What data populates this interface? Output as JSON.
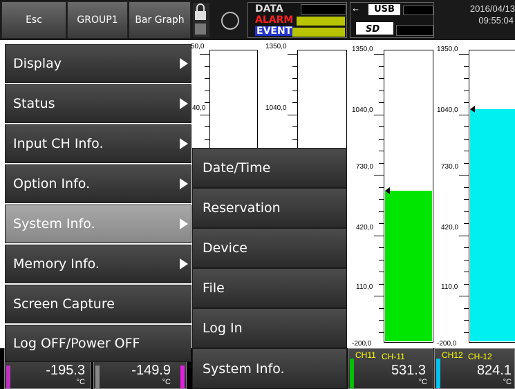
{
  "topbar": {
    "esc_label": "Esc",
    "group_label": "GROUP1",
    "view_label": "Bar Graph",
    "data_label": "DATA",
    "alarm_label": "ALARM",
    "event_label": "EVENT",
    "usb_label": "USB",
    "date": "2016/04/13",
    "time": "09:55:04"
  },
  "chart": {
    "bars": [
      {
        "scale": [
          "50,0",
          "40,0"
        ]
      },
      {
        "scale": [
          "1350,0",
          "1040,0"
        ]
      },
      {
        "scale": [
          "1350,0",
          "1040,0",
          "730,0",
          "420,0",
          "110,0",
          "-200,0"
        ],
        "level_pct": 52
      },
      {
        "scale": [
          "1350,0",
          "1040,0",
          "730,0",
          "420,0",
          "110,0",
          "-200,0"
        ],
        "level_pct": 80
      }
    ],
    "colors": {
      "ch11": "#00e600",
      "ch12": "#00f0f0"
    }
  },
  "bottom": {
    "tiles": [
      {
        "value": "-195.3",
        "unit": "°C"
      },
      {
        "value": "-149.9",
        "unit": "°C"
      },
      {
        "ch": "CH11",
        "name": "CH-11",
        "value": "531.3",
        "unit": "°C"
      },
      {
        "ch": "CH12",
        "name": "CH-12",
        "value": "824.1",
        "unit": "°C"
      }
    ]
  },
  "menu": {
    "items": [
      {
        "label": "Display"
      },
      {
        "label": "Status"
      },
      {
        "label": "Input CH Info."
      },
      {
        "label": "Option Info."
      },
      {
        "label": "System Info."
      },
      {
        "label": "Memory Info."
      },
      {
        "label": "Screen Capture"
      },
      {
        "label": "Log OFF/Power OFF"
      }
    ],
    "selected": "System Info."
  },
  "submenu": {
    "items": [
      {
        "label": "Date/Time"
      },
      {
        "label": "Reservation"
      },
      {
        "label": "Device"
      },
      {
        "label": "File"
      },
      {
        "label": "Log In"
      },
      {
        "label": "System Info."
      }
    ]
  }
}
